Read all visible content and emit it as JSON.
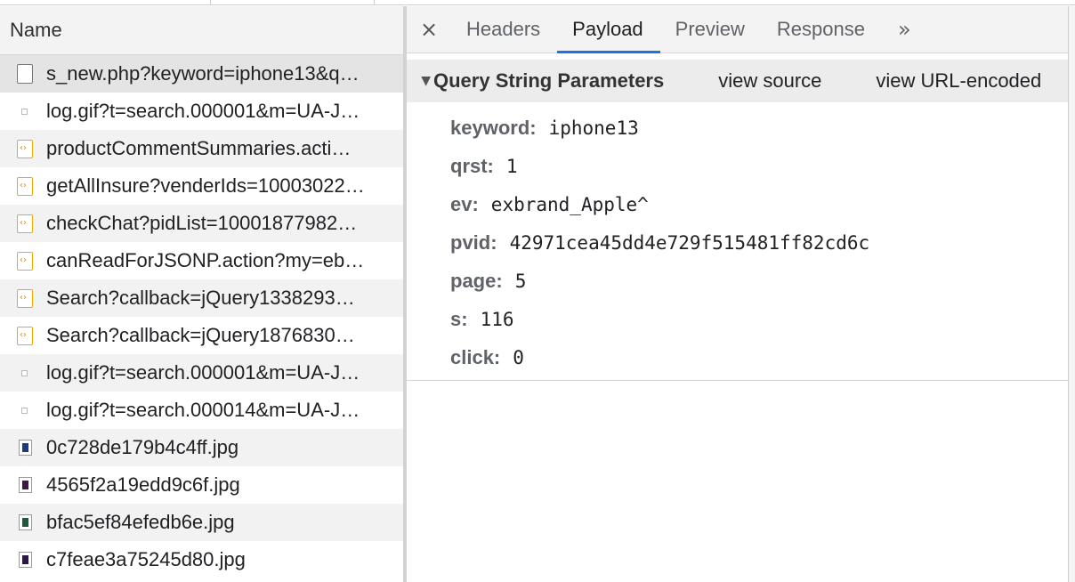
{
  "colors": {
    "accent": "#1a73e8",
    "script_icon": "#f2a900",
    "selected_row": "#e4e4e4"
  },
  "request_list": {
    "header": "Name",
    "rows": [
      {
        "name": "s_new.php?keyword=iphone13&q…",
        "icon": "document-icon",
        "selected": true
      },
      {
        "name": "log.gif?t=search.000001&m=UA-J…",
        "icon": "pixel-icon"
      },
      {
        "name": "productCommentSummaries.acti…",
        "icon": "script-icon"
      },
      {
        "name": "getAllInsure?venderIds=10003022…",
        "icon": "script-icon"
      },
      {
        "name": "checkChat?pidList=10001877982…",
        "icon": "script-icon"
      },
      {
        "name": "canReadForJSONP.action?my=eb…",
        "icon": "script-icon"
      },
      {
        "name": "Search?callback=jQuery1338293…",
        "icon": "script-icon"
      },
      {
        "name": "Search?callback=jQuery1876830…",
        "icon": "script-icon"
      },
      {
        "name": "log.gif?t=search.000001&m=UA-J…",
        "icon": "pixel-icon"
      },
      {
        "name": "log.gif?t=search.000014&m=UA-J…",
        "icon": "pixel-icon"
      },
      {
        "name": "0c728de179b4c4ff.jpg",
        "icon": "image-icon",
        "thumb": "#1d3a7a"
      },
      {
        "name": "4565f2a19edd9c6f.jpg",
        "icon": "image-icon",
        "thumb": "#3a1a3f"
      },
      {
        "name": "bfac5ef84efedb6e.jpg",
        "icon": "image-icon",
        "thumb": "#1f5a3a"
      },
      {
        "name": "c7feae3a75245d80.jpg",
        "icon": "image-icon",
        "thumb": "#2a1a4a"
      }
    ]
  },
  "detail": {
    "close_glyph": "×",
    "tabs": [
      {
        "label": "Headers"
      },
      {
        "label": "Payload",
        "active": true
      },
      {
        "label": "Preview"
      },
      {
        "label": "Response"
      }
    ],
    "more_glyph": "»",
    "section": {
      "title": "Query String Parameters",
      "view_source": "view source",
      "view_url_encoded": "view URL-encoded"
    },
    "params": [
      {
        "key": "keyword:",
        "value": "iphone13"
      },
      {
        "key": "qrst:",
        "value": "1"
      },
      {
        "key": "ev:",
        "value": "exbrand_Apple^"
      },
      {
        "key": "pvid:",
        "value": "42971cea45dd4e729f515481ff82cd6c"
      },
      {
        "key": "page:",
        "value": "5"
      },
      {
        "key": "s:",
        "value": "116"
      },
      {
        "key": "click:",
        "value": "0"
      }
    ]
  }
}
